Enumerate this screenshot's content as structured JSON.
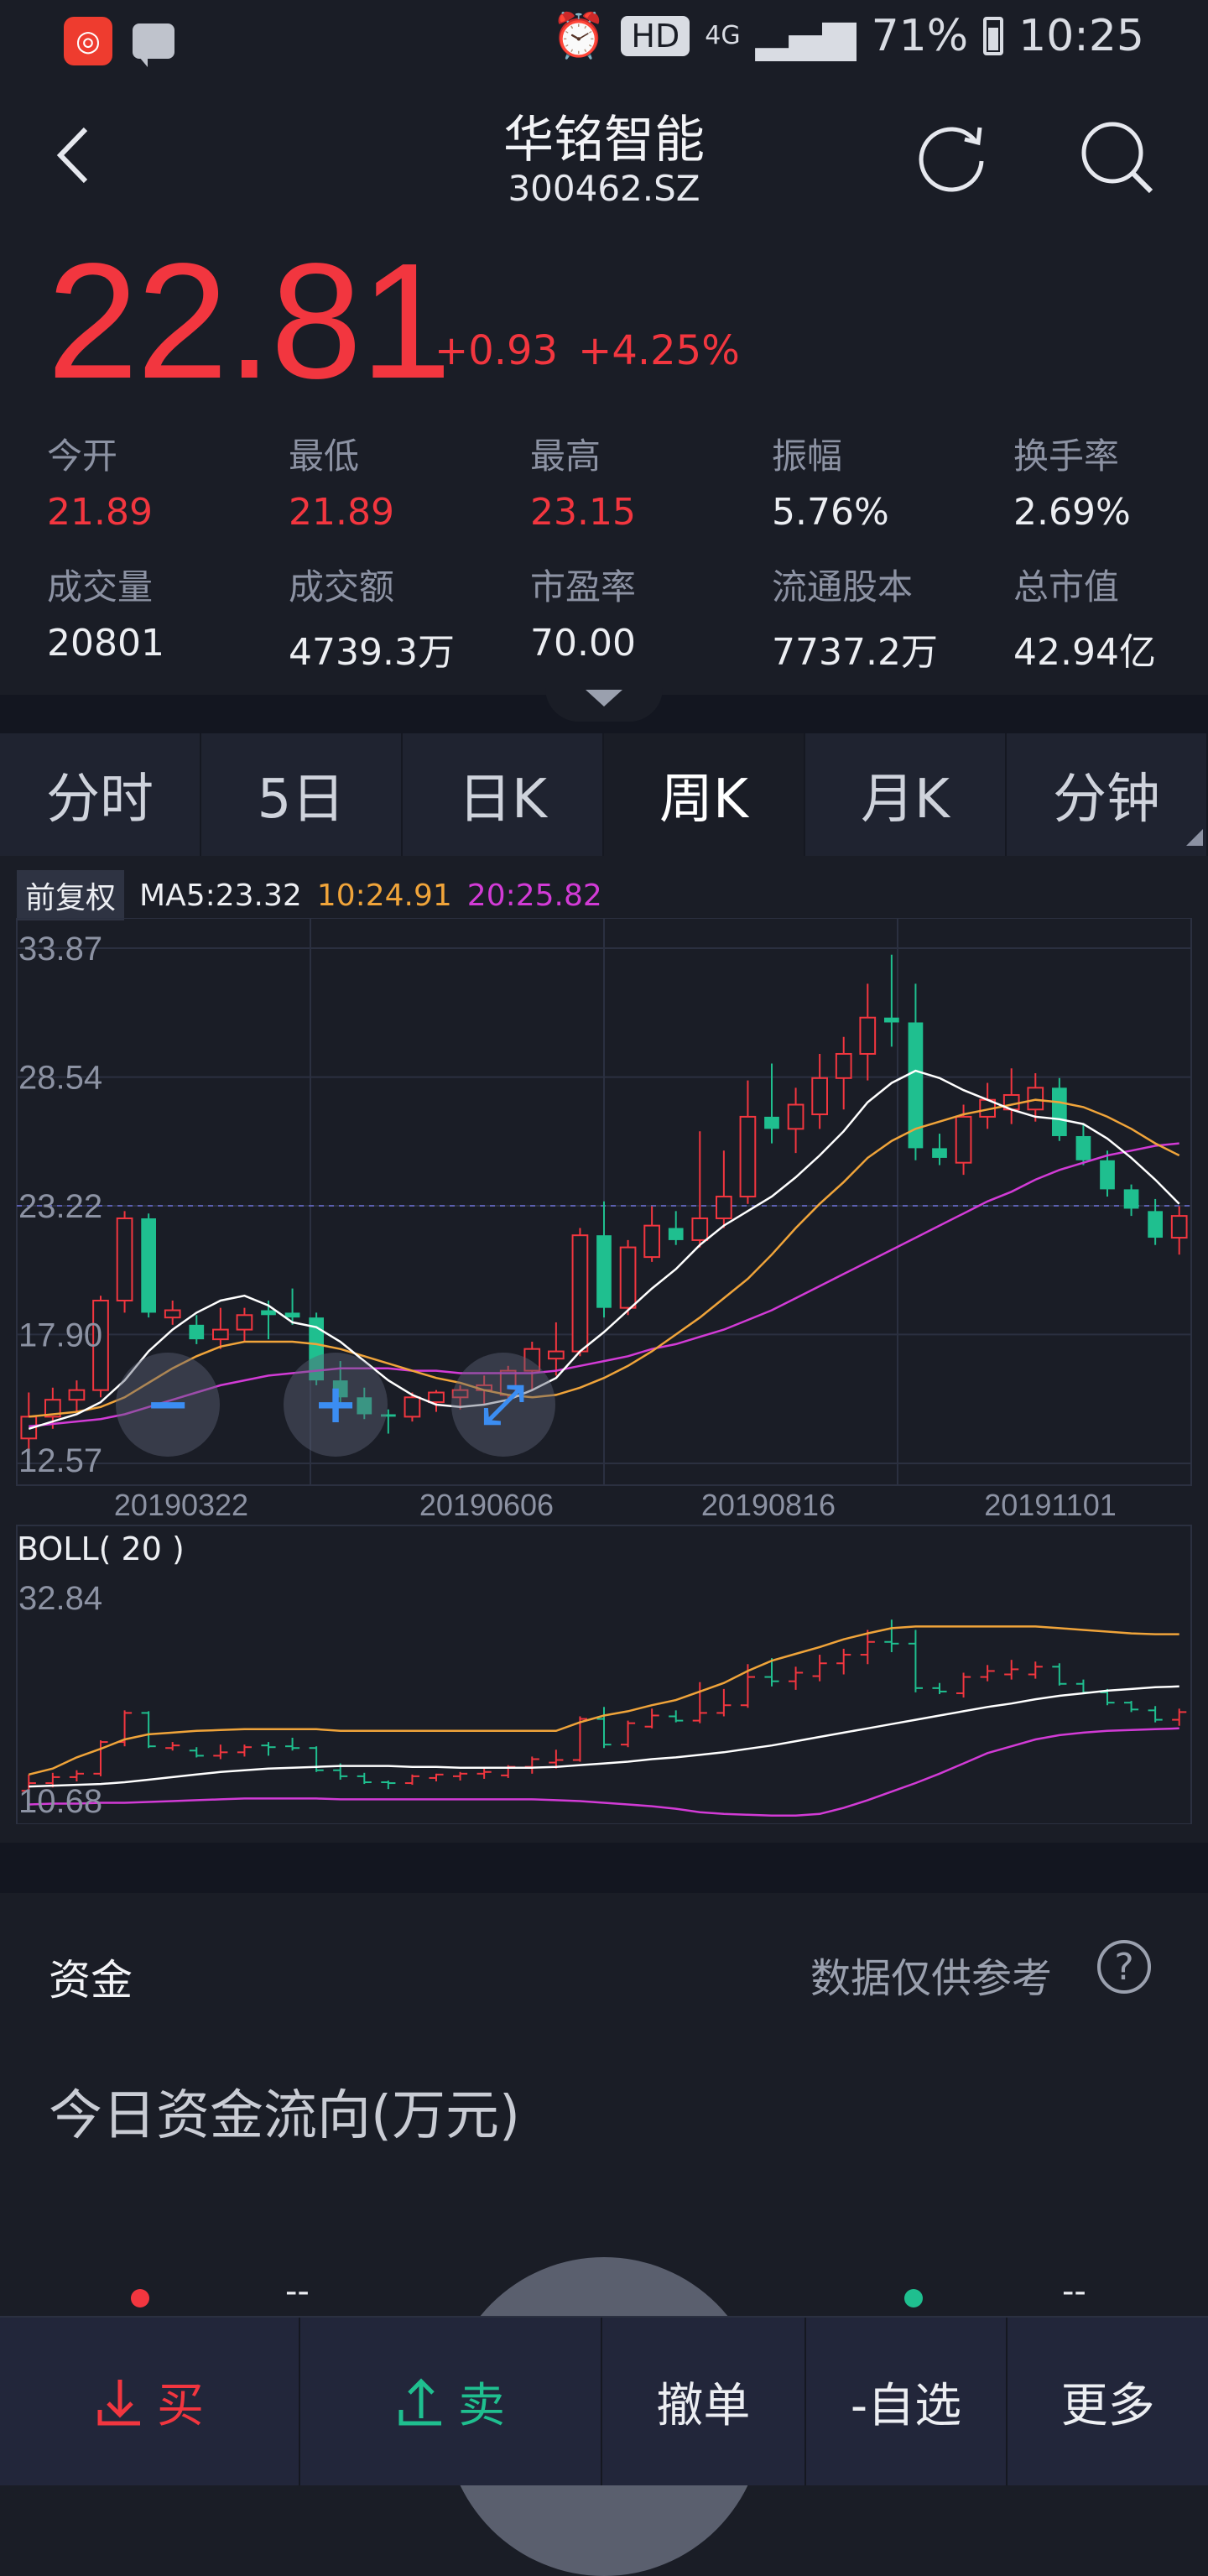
{
  "status_bar": {
    "battery": "71%",
    "time": "10:25",
    "hd": "HD",
    "network": "4G"
  },
  "header": {
    "title": "华铭智能",
    "code": "300462.SZ"
  },
  "quote": {
    "price": "22.81",
    "change": "+0.93",
    "change_pct": "+4.25%"
  },
  "stats": [
    {
      "label": "今开",
      "value": "21.89",
      "color": "red"
    },
    {
      "label": "最低",
      "value": "21.89",
      "color": "red"
    },
    {
      "label": "最高",
      "value": "23.15",
      "color": "red"
    },
    {
      "label": "振幅",
      "value": "5.76%",
      "color": "white"
    },
    {
      "label": "换手率",
      "value": "2.69%",
      "color": "white"
    },
    {
      "label": "成交量",
      "value": "20801",
      "color": "white"
    },
    {
      "label": "成交额",
      "value": "4739.3万",
      "color": "white"
    },
    {
      "label": "市盈率",
      "value": "70.00",
      "color": "white"
    },
    {
      "label": "流通股本",
      "value": "7737.2万",
      "color": "white"
    },
    {
      "label": "总市值",
      "value": "42.94亿",
      "color": "white"
    }
  ],
  "tabs": [
    "分时",
    "5日",
    "日K",
    "周K",
    "月K",
    "分钟"
  ],
  "active_tab": "周K",
  "legend": {
    "adjust": "前复权",
    "ma5": "MA5:23.32",
    "ma10": "10:24.91",
    "ma20": "20:25.82"
  },
  "zoom_controls": {
    "zoom_out": "−",
    "zoom_in": "+",
    "fullscreen": "⤢"
  },
  "chart_data": [
    {
      "type": "candlestick",
      "title": "",
      "ylim": [
        12.57,
        33.87
      ],
      "y_ticks": [
        "33.87",
        "28.54",
        "23.22",
        "17.90",
        "12.57"
      ],
      "x_ticks": [
        "20190322",
        "20190606",
        "20190816",
        "20191101"
      ],
      "last_price_line": 23.22,
      "colors": {
        "up": "#f2363f",
        "down": "#1fbf8f",
        "ma5": "#ffffff",
        "ma10": "#f0a43a",
        "ma20": "#d23bd6"
      },
      "candles": [
        {
          "o": 13.6,
          "h": 15.5,
          "l": 12.8,
          "c": 14.5
        },
        {
          "o": 14.5,
          "h": 15.7,
          "l": 14.0,
          "c": 15.2
        },
        {
          "o": 15.2,
          "h": 16.0,
          "l": 14.7,
          "c": 15.6
        },
        {
          "o": 15.6,
          "h": 19.5,
          "l": 15.3,
          "c": 19.3
        },
        {
          "o": 19.3,
          "h": 23.0,
          "l": 18.8,
          "c": 22.7
        },
        {
          "o": 22.7,
          "h": 22.9,
          "l": 18.6,
          "c": 18.8
        },
        {
          "o": 18.6,
          "h": 19.3,
          "l": 18.3,
          "c": 18.9
        },
        {
          "o": 18.3,
          "h": 18.7,
          "l": 17.5,
          "c": 17.7
        },
        {
          "o": 17.7,
          "h": 19.0,
          "l": 17.3,
          "c": 18.1
        },
        {
          "o": 18.1,
          "h": 19.0,
          "l": 17.6,
          "c": 18.7
        },
        {
          "o": 18.9,
          "h": 19.3,
          "l": 17.7,
          "c": 18.7
        },
        {
          "o": 18.8,
          "h": 19.8,
          "l": 18.3,
          "c": 18.6
        },
        {
          "o": 18.6,
          "h": 18.8,
          "l": 15.8,
          "c": 16.0
        },
        {
          "o": 16.0,
          "h": 16.8,
          "l": 14.9,
          "c": 15.3
        },
        {
          "o": 15.3,
          "h": 15.7,
          "l": 14.4,
          "c": 14.6
        },
        {
          "o": 14.6,
          "h": 14.8,
          "l": 13.8,
          "c": 14.5
        },
        {
          "o": 14.5,
          "h": 15.5,
          "l": 14.3,
          "c": 15.3
        },
        {
          "o": 15.1,
          "h": 15.6,
          "l": 14.7,
          "c": 15.5
        },
        {
          "o": 15.3,
          "h": 15.8,
          "l": 14.8,
          "c": 15.6
        },
        {
          "o": 15.6,
          "h": 16.2,
          "l": 15.0,
          "c": 15.8
        },
        {
          "o": 15.4,
          "h": 16.6,
          "l": 15.1,
          "c": 16.4
        },
        {
          "o": 16.4,
          "h": 17.6,
          "l": 15.6,
          "c": 17.3
        },
        {
          "o": 16.9,
          "h": 18.4,
          "l": 16.2,
          "c": 17.2
        },
        {
          "o": 17.2,
          "h": 22.3,
          "l": 17.0,
          "c": 22.0
        },
        {
          "o": 22.0,
          "h": 23.4,
          "l": 18.6,
          "c": 19.0
        },
        {
          "o": 19.0,
          "h": 21.8,
          "l": 18.7,
          "c": 21.5
        },
        {
          "o": 21.1,
          "h": 23.2,
          "l": 20.9,
          "c": 22.4
        },
        {
          "o": 22.3,
          "h": 23.0,
          "l": 21.6,
          "c": 21.8
        },
        {
          "o": 21.8,
          "h": 26.3,
          "l": 21.5,
          "c": 22.7
        },
        {
          "o": 22.7,
          "h": 25.5,
          "l": 22.3,
          "c": 23.6
        },
        {
          "o": 23.6,
          "h": 28.4,
          "l": 23.3,
          "c": 26.9
        },
        {
          "o": 26.9,
          "h": 29.1,
          "l": 25.8,
          "c": 26.4
        },
        {
          "o": 26.4,
          "h": 28.1,
          "l": 25.4,
          "c": 27.4
        },
        {
          "o": 27.0,
          "h": 29.5,
          "l": 26.4,
          "c": 28.5
        },
        {
          "o": 28.5,
          "h": 30.2,
          "l": 27.2,
          "c": 29.5
        },
        {
          "o": 29.5,
          "h": 32.4,
          "l": 28.4,
          "c": 31.0
        },
        {
          "o": 31.0,
          "h": 33.6,
          "l": 29.8,
          "c": 30.8
        },
        {
          "o": 30.8,
          "h": 32.4,
          "l": 25.1,
          "c": 25.6
        },
        {
          "o": 25.6,
          "h": 26.2,
          "l": 24.9,
          "c": 25.2
        },
        {
          "o": 25.0,
          "h": 27.4,
          "l": 24.5,
          "c": 26.9
        },
        {
          "o": 26.9,
          "h": 28.3,
          "l": 26.4,
          "c": 27.6
        },
        {
          "o": 27.2,
          "h": 28.9,
          "l": 26.6,
          "c": 27.8
        },
        {
          "o": 27.2,
          "h": 28.7,
          "l": 26.7,
          "c": 28.1
        },
        {
          "o": 28.1,
          "h": 28.5,
          "l": 25.9,
          "c": 26.1
        },
        {
          "o": 26.1,
          "h": 26.6,
          "l": 24.9,
          "c": 25.1
        },
        {
          "o": 25.1,
          "h": 25.5,
          "l": 23.6,
          "c": 23.9
        },
        {
          "o": 23.9,
          "h": 24.1,
          "l": 22.8,
          "c": 23.1
        },
        {
          "o": 23.0,
          "h": 23.5,
          "l": 21.6,
          "c": 21.9
        },
        {
          "o": 21.9,
          "h": 23.2,
          "l": 21.2,
          "c": 22.8
        }
      ],
      "ma5": [
        14.0,
        14.3,
        14.6,
        15.1,
        16.0,
        17.2,
        18.1,
        18.8,
        19.3,
        19.5,
        19.1,
        18.4,
        18.2,
        17.6,
        16.8,
        16.0,
        15.4,
        15.0,
        14.9,
        15.0,
        15.2,
        15.6,
        16.1,
        17.2,
        18.0,
        18.9,
        19.8,
        20.6,
        21.6,
        22.4,
        23.0,
        23.6,
        24.4,
        25.3,
        26.3,
        27.5,
        28.3,
        28.8,
        28.5,
        28.0,
        27.6,
        27.2,
        26.9,
        26.8,
        26.6,
        26.0,
        25.2,
        24.3,
        23.3
      ],
      "ma10": [
        14.5,
        14.6,
        14.7,
        14.9,
        15.3,
        15.9,
        16.5,
        17.0,
        17.4,
        17.6,
        17.6,
        17.6,
        17.5,
        17.3,
        17.0,
        16.7,
        16.4,
        16.1,
        15.9,
        15.6,
        15.4,
        15.3,
        15.4,
        15.7,
        16.1,
        16.6,
        17.2,
        17.9,
        18.6,
        19.4,
        20.2,
        21.2,
        22.3,
        23.3,
        24.2,
        25.2,
        25.9,
        26.4,
        26.7,
        27.0,
        27.2,
        27.4,
        27.6,
        27.5,
        27.3,
        26.9,
        26.4,
        25.8,
        25.3
      ],
      "ma20": [
        14.1,
        14.2,
        14.3,
        14.4,
        14.6,
        14.9,
        15.2,
        15.5,
        15.8,
        16.0,
        16.2,
        16.3,
        16.4,
        16.5,
        16.5,
        16.5,
        16.4,
        16.4,
        16.3,
        16.3,
        16.3,
        16.3,
        16.4,
        16.6,
        16.8,
        17.0,
        17.3,
        17.5,
        17.8,
        18.1,
        18.5,
        18.9,
        19.4,
        19.9,
        20.4,
        20.9,
        21.4,
        21.9,
        22.4,
        22.9,
        23.4,
        23.8,
        24.3,
        24.7,
        25.0,
        25.3,
        25.5,
        25.7,
        25.8
      ]
    },
    {
      "type": "boll",
      "label": "BOLL( 20 )",
      "ylim": [
        10.68,
        32.84
      ],
      "y_ticks": [
        "32.84",
        "10.68"
      ],
      "mid": [
        14.1,
        14.2,
        14.3,
        14.4,
        14.6,
        14.9,
        15.2,
        15.5,
        15.8,
        16.0,
        16.2,
        16.3,
        16.4,
        16.5,
        16.5,
        16.5,
        16.4,
        16.4,
        16.3,
        16.3,
        16.3,
        16.3,
        16.4,
        16.6,
        16.8,
        17.0,
        17.3,
        17.5,
        17.8,
        18.1,
        18.5,
        18.9,
        19.4,
        19.9,
        20.4,
        20.9,
        21.4,
        21.9,
        22.4,
        22.9,
        23.4,
        23.8,
        24.3,
        24.7,
        25.0,
        25.3,
        25.5,
        25.7,
        25.8
      ],
      "upper": [
        15.5,
        16.2,
        17.5,
        18.5,
        19.6,
        20.2,
        20.4,
        20.6,
        20.7,
        20.8,
        20.8,
        20.8,
        20.8,
        20.6,
        20.6,
        20.6,
        20.6,
        20.6,
        20.6,
        20.6,
        20.6,
        20.6,
        20.6,
        21.6,
        22.4,
        22.9,
        23.6,
        24.2,
        25.2,
        26.2,
        27.6,
        28.8,
        29.6,
        30.4,
        31.3,
        32.0,
        32.6,
        32.8,
        32.8,
        32.8,
        32.8,
        32.8,
        32.8,
        32.6,
        32.4,
        32.2,
        32.0,
        31.9,
        31.9
      ],
      "lower": [
        12.0,
        12.1,
        12.1,
        12.2,
        12.2,
        12.3,
        12.4,
        12.5,
        12.6,
        12.7,
        12.7,
        12.7,
        12.7,
        12.6,
        12.6,
        12.6,
        12.6,
        12.6,
        12.6,
        12.6,
        12.6,
        12.6,
        12.5,
        12.4,
        12.2,
        12.0,
        11.8,
        11.5,
        11.1,
        10.9,
        10.8,
        10.7,
        10.7,
        10.9,
        11.6,
        12.5,
        13.5,
        14.5,
        15.6,
        16.8,
        18.0,
        18.8,
        19.6,
        20.1,
        20.4,
        20.6,
        20.7,
        20.8,
        20.9
      ]
    }
  ],
  "funds": {
    "title": "资金",
    "note": "数据仅供参考",
    "help": "?",
    "flow_title": "今日资金流向(万元)",
    "inflow": "--",
    "outflow": "--"
  },
  "bottom_bar": {
    "buy": "买",
    "sell": "卖",
    "cancel": "撤单",
    "watch": "-自选",
    "more": "更多"
  }
}
